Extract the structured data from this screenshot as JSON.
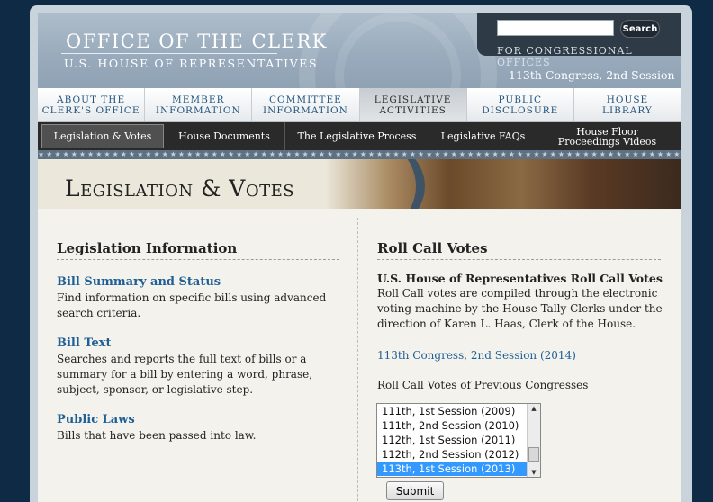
{
  "header": {
    "office_title": "Office of the Clerk",
    "office_subtitle": "U.S. House of Representatives",
    "search_button": "Search",
    "search_placeholder": "",
    "congress_offices": "For Congressional Offices",
    "session": "113th Congress, 2nd Session"
  },
  "main_nav": [
    {
      "line1": "About the",
      "line2": "Clerk's Office",
      "active": false
    },
    {
      "line1": "Member",
      "line2": "Information",
      "active": false
    },
    {
      "line1": "Committee",
      "line2": "Information",
      "active": false
    },
    {
      "line1": "Legislative",
      "line2": "Activities",
      "active": true
    },
    {
      "line1": "Public",
      "line2": "Disclosure",
      "active": false
    },
    {
      "line1": "House",
      "line2": "Library",
      "active": false
    }
  ],
  "sub_nav": {
    "legislation_votes": "Legislation & Votes",
    "house_documents": "House Documents",
    "legislative_process": "The Legislative Process",
    "legislative_faqs": "Legislative FAQs",
    "floor_videos_line1": "House Floor",
    "floor_videos_line2": "Proceedings Videos"
  },
  "banner": {
    "title": "Legislation & Votes"
  },
  "left_column": {
    "heading": "Legislation Information",
    "bill_summary": {
      "title": "Bill Summary and Status",
      "desc1": "Find information on specific bills using advanced",
      "desc2": "search criteria."
    },
    "bill_text": {
      "title": "Bill Text",
      "desc1": "Searches and reports the full text of bills or a",
      "desc2": "summary for a bill by entering a word, phrase,",
      "desc3": "subject, sponsor, or legislative step."
    },
    "public_laws": {
      "title": "Public Laws",
      "desc1": "Bills that have been passed into law."
    }
  },
  "right_column": {
    "heading": "Roll Call Votes",
    "subheading": "U.S. House of Representatives Roll Call Votes",
    "desc1": "Roll Call votes are compiled through the electronic",
    "desc2": "voting machine by the House Tally Clerks under the",
    "desc3": "direction of Karen L. Haas, Clerk of the House.",
    "current_link": "113th Congress, 2nd Session (2014)",
    "previous_label": "Roll Call Votes of Previous Congresses",
    "options": [
      "111th, 1st Session (2009)",
      "111th, 2nd Session (2010)",
      "112th, 1st Session (2011)",
      "112th, 2nd Session (2012)",
      "113th, 1st Session (2013)"
    ],
    "selected_option": "113th, 1st Session (2013)",
    "submit": "Submit"
  },
  "colors": {
    "link": "#1f5f95",
    "selection": "#3399ff",
    "background": "#0f2a45"
  }
}
